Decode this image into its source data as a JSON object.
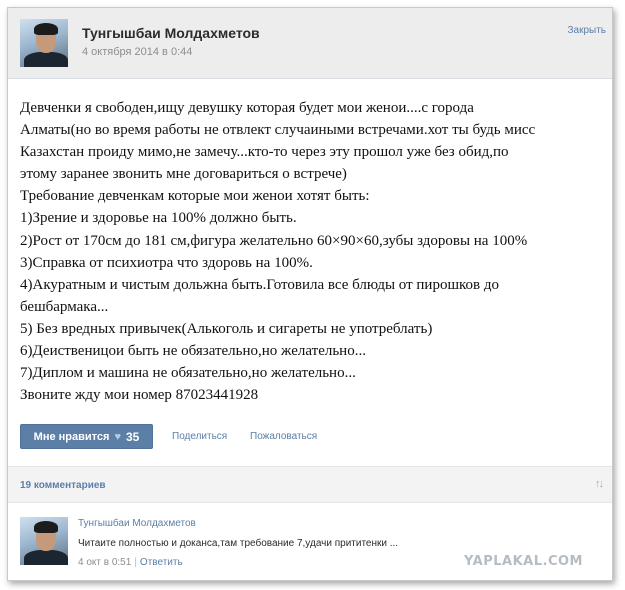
{
  "post": {
    "author": "Тунгышбаи Молдахметов",
    "date": "4 октября 2014 в 0:44",
    "close_label": "Закрыть",
    "lines": [
      "Девченки я свободен,ищу девушку которая будет мои женои....с города",
      "Алматы(но во время работы не отвлект случаиными встречами.хот ты будь мисс",
      "Казахстан проиду мимо,не замечу...кто-то через эту прошол уже без обид,по",
      "этому заранее звонить мне договариться о встрече)",
      "Требование девченкам которые мои женои хотят быть:",
      "1)Зрение и здоровье на 100% должно быть.",
      "2)Рост от 170см до 181 см,фигура желательно 60×90×60,зубы здоровы на 100%",
      "3)Справка от психиотра что здоровь на 100%.",
      "4)Акуратным и чистым дольжна быть.Готовила все блюды от пирошков до",
      "бешбармака...",
      "5) Без вредных привычек(Алькоголь и сигареты не употреблать)",
      "6)Деиственицои быть не обязательно,но желательно...",
      "7)Диплом и машина не обязательно,но желательно...",
      "Звоните жду мои номер 87023441928"
    ]
  },
  "actions": {
    "like_label": "Мне нравится",
    "like_icon": "heart-icon",
    "like_count": "35",
    "share_label": "Поделиться",
    "report_label": "Пожаловаться"
  },
  "comments": {
    "count_label": "19 комментариев",
    "sort_icon": "sort-arrows-icon",
    "items": [
      {
        "author": "Тунгышбаи Молдахметов",
        "text": "Читаите полностью и доканса,там требование 7,удачи прититенки ...",
        "time": "4 окт в 0:51",
        "reply_label": "Ответить"
      }
    ]
  },
  "watermark": "YAPLAKAL.COM",
  "colors": {
    "link": "#5b7fa6",
    "header_bg": "#ededed",
    "button_bg": "#5b7fa6"
  }
}
